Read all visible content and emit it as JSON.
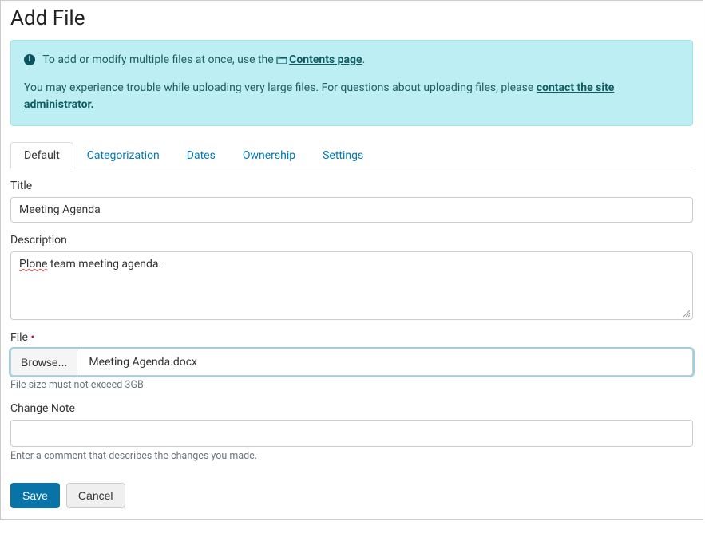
{
  "page": {
    "heading": "Add File"
  },
  "info": {
    "line1_prefix": "To add or modify multiple files at once, use the ",
    "contents_link": "Contents page",
    "line1_suffix": ".",
    "line2_prefix": "You may experience trouble while uploading very large files. For questions about uploading files, please ",
    "contact_link": "contact the site administrator."
  },
  "tabs": {
    "items": [
      {
        "label": "Default",
        "active": true
      },
      {
        "label": "Categorization",
        "active": false
      },
      {
        "label": "Dates",
        "active": false
      },
      {
        "label": "Ownership",
        "active": false
      },
      {
        "label": "Settings",
        "active": false
      }
    ]
  },
  "form": {
    "title": {
      "label": "Title",
      "value": "Meeting Agenda"
    },
    "description": {
      "label": "Description",
      "misspelled_word": "Plone",
      "rest": " team meeting agenda."
    },
    "file": {
      "label": "File",
      "required_marker": "•",
      "browse_label": "Browse...",
      "filename": "Meeting Agenda.docx",
      "help": "File size must not exceed 3GB"
    },
    "change_note": {
      "label": "Change Note",
      "value": "",
      "help": "Enter a comment that describes the changes you made."
    }
  },
  "actions": {
    "save": "Save",
    "cancel": "Cancel"
  }
}
